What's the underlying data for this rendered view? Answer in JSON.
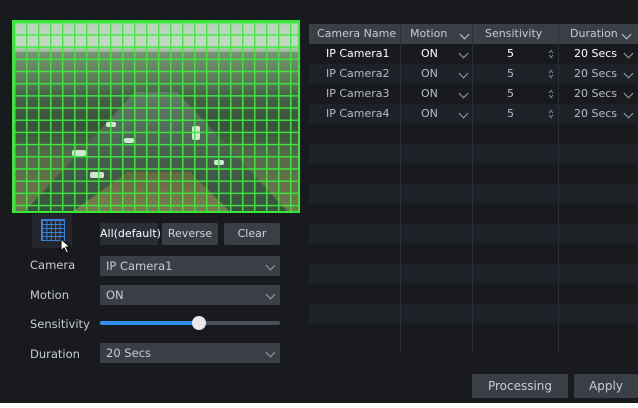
{
  "toolbar": {
    "all_label": "All(default)",
    "reverse_label": "Reverse",
    "clear_label": "Clear"
  },
  "form": {
    "camera": {
      "label": "Camera",
      "value": "IP Camera1"
    },
    "motion": {
      "label": "Motion",
      "value": "ON"
    },
    "sensitivity": {
      "label": "Sensitivity",
      "level_fraction": 0.55
    },
    "duration": {
      "label": "Duration",
      "value": "20 Secs"
    }
  },
  "table": {
    "headers": [
      "Camera Name",
      "Motion",
      "Sensitivity",
      "Duration"
    ],
    "rows": [
      {
        "camera": "IP Camera1",
        "motion": "ON",
        "sensitivity": "5",
        "duration": "20 Secs",
        "selected": true
      },
      {
        "camera": "IP Camera2",
        "motion": "ON",
        "sensitivity": "5",
        "duration": "20 Secs",
        "selected": false
      },
      {
        "camera": "IP Camera3",
        "motion": "ON",
        "sensitivity": "5",
        "duration": "20 Secs",
        "selected": false
      },
      {
        "camera": "IP Camera4",
        "motion": "ON",
        "sensitivity": "5",
        "duration": "20 Secs",
        "selected": false
      }
    ]
  },
  "actions": {
    "processing_mode_label": "Processing Mode",
    "apply_label": "Apply"
  },
  "colors": {
    "grid": "#38e838",
    "accent": "#2f8ff0",
    "panel": "#181a1e",
    "control": "#3a3f47"
  }
}
